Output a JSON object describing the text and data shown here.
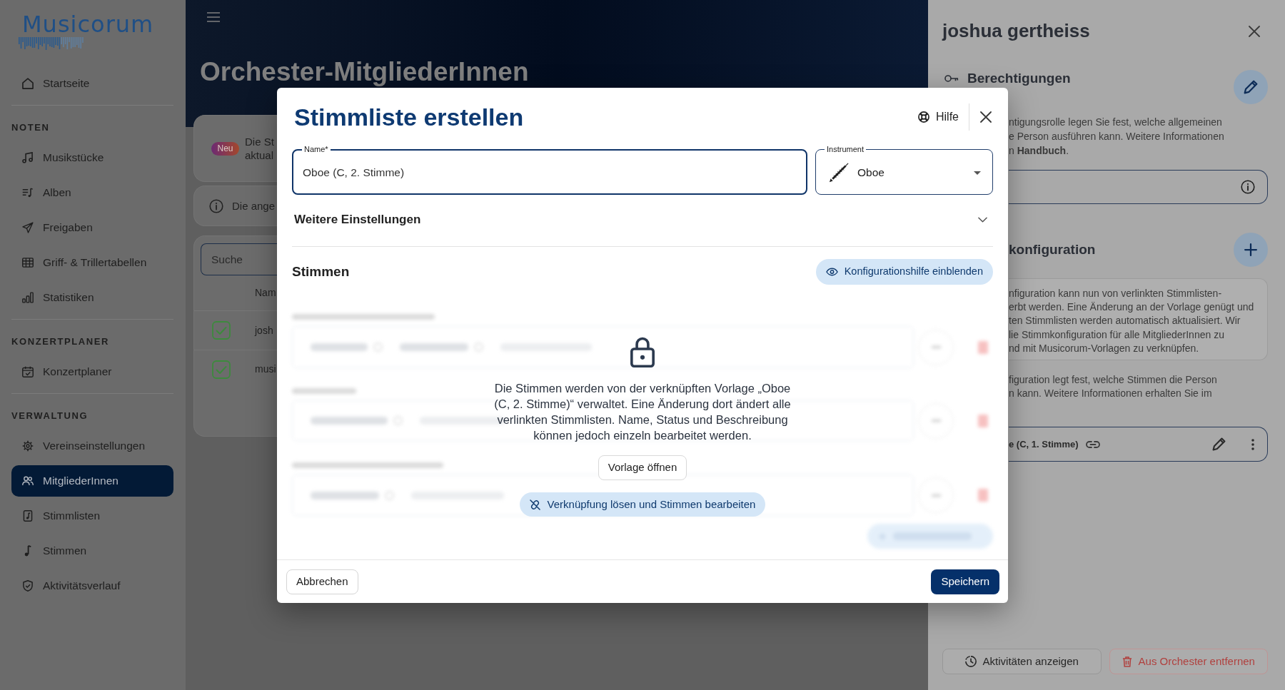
{
  "sidebar": {
    "logo": "Musicorum",
    "sections": [
      {
        "items": [
          {
            "label": "Startseite",
            "selected": false
          }
        ]
      },
      {
        "heading": "NOTEN",
        "items": [
          {
            "label": "Musikstücke",
            "selected": false
          },
          {
            "label": "Alben",
            "selected": false
          },
          {
            "label": "Freigaben",
            "selected": false
          },
          {
            "label": "Griff- & Trillertabellen",
            "selected": false
          },
          {
            "label": "Statistiken",
            "selected": false
          }
        ]
      },
      {
        "heading": "KONZERTPLANER",
        "items": [
          {
            "label": "Konzertplaner",
            "selected": false
          }
        ]
      },
      {
        "heading": "VERWALTUNG",
        "items": [
          {
            "label": "Vereinseinstellungen",
            "selected": false
          },
          {
            "label": "MitgliederInnen",
            "selected": true
          },
          {
            "label": "Stimmlisten",
            "selected": false
          },
          {
            "label": "Stimmen",
            "selected": false
          },
          {
            "label": "Aktivitätsverlauf",
            "selected": false
          }
        ]
      }
    ]
  },
  "page": {
    "title": "Orchester-MitgliederInnen",
    "news": {
      "badge": "Neu",
      "lines": [
        "Die St",
        "aktual"
      ]
    },
    "info": {
      "text": "Die ange"
    },
    "members": {
      "search": {
        "placeholder": "Suche"
      },
      "columns": [
        "Nam"
      ],
      "rows": [
        {
          "checked": true,
          "cells": [
            "josh"
          ]
        },
        {
          "checked": true,
          "cells": [
            "musi"
          ]
        }
      ]
    }
  },
  "modal": {
    "title": "Stimmliste erstellen",
    "help": "Hilfe",
    "fields": [
      {
        "kind": "text",
        "label": "Name*",
        "value": "Oboe (C, 2. Stimme)",
        "focused": true
      },
      {
        "kind": "select",
        "label": "Instrument",
        "value": "Oboe",
        "focused": false
      }
    ],
    "more_settings": {
      "label": "Weitere Einstellungen",
      "expanded": false
    },
    "voices": {
      "heading": "Stimmen",
      "help_button": "Konfigurationshilfe einblenden",
      "lock_message": "Die Stimmen werden von der verknüpften Vorlage „Oboe (C, 2. Stimme)“ verwaltet. Eine Änderung dort ändert alle verlinkten Stimmlisten. Name, Status und Beschreibung können jedoch einzeln bearbeitet werden.",
      "open_template": "Vorlage öffnen",
      "unlink": "Verknüpfung lösen und Stimmen bearbeiten"
    },
    "buttons": [
      {
        "label": "Abbrechen",
        "kind": "secondary"
      },
      {
        "label": "Speichern",
        "kind": "primary"
      }
    ]
  },
  "member_panel": {
    "title": "joshua gertheiss",
    "permissions": {
      "heading": "Berechtigungen",
      "description_lines": [
        "ntigungsrolle legen Sie fest, welche allgemeinen",
        "e Person ausführen kann. Weitere Informationen",
        "n"
      ],
      "link": "Handbuch",
      "link_suffix": "."
    },
    "voice_config": {
      "heading": "konfiguration",
      "notice_lines": [
        "nfiguration kann nun von verlinkten Stimmlisten-",
        "erbt werden. Eine Änderung an der Vorlage genügt und",
        "ten Stimmlisten werden automatisch aktualisiert. Wir",
        "lie Stimmkonfiguration für alle MitgliederInnen zu",
        "nd mit Musicorum-Vorlagen zu verknüpfen."
      ],
      "description_lines": [
        "figuration legt fest, welche Stimmen die Person",
        "n kann. Weitere Informationen erhalten Sie im"
      ],
      "template": "e (C, 1. Stimme)"
    },
    "actions": [
      {
        "label": "Aktivitäten anzeigen",
        "kind": "default"
      },
      {
        "label": "Aus Orchester entfernen",
        "kind": "danger"
      }
    ]
  }
}
